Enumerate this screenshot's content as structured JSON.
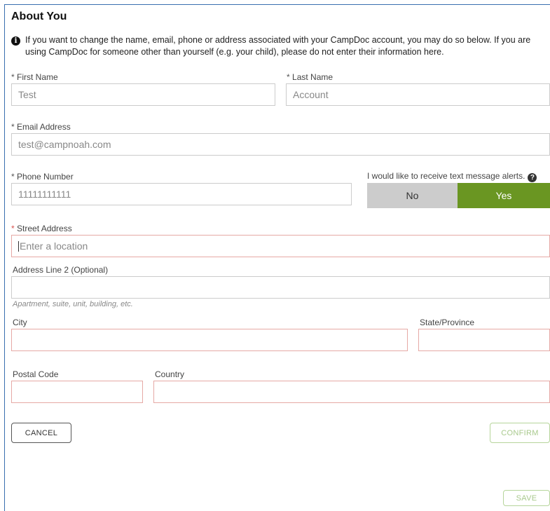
{
  "section": {
    "title": "About You",
    "info_text": "If you want to change the name, email, phone or address associated with your CampDoc account, you may do so below. If you are using CampDoc for someone other than yourself (e.g. your child), please do not enter their information here."
  },
  "icons": {
    "info": "info-circle-icon",
    "help": "question-circle-icon"
  },
  "form": {
    "first_name": {
      "label": "First Name",
      "value": "Test"
    },
    "last_name": {
      "label": "Last Name",
      "value": "Account"
    },
    "email": {
      "label": "Email Address",
      "value": "test@campnoah.com"
    },
    "phone": {
      "label": "Phone Number",
      "value": "11111111111"
    },
    "text_alerts": {
      "label": "I would like to receive text message alerts.",
      "no": "No",
      "yes": "Yes",
      "selected": "Yes"
    },
    "street": {
      "label": "Street Address",
      "placeholder": "Enter a location"
    },
    "address2": {
      "label": "Address Line 2 (Optional)",
      "hint": "Apartment, suite, unit, building, etc."
    },
    "city": {
      "label": "City"
    },
    "state": {
      "label": "State/Province"
    },
    "postal": {
      "label": "Postal Code"
    },
    "country": {
      "label": "Country"
    },
    "required_marker": "*"
  },
  "buttons": {
    "cancel": "CANCEL",
    "confirm": "CONFIRM",
    "save": "SAVE"
  },
  "colors": {
    "accent_green": "#6a9622",
    "error_border": "#e6a9a5",
    "required_red": "#d9534f",
    "frame_blue": "#3a6fb0"
  }
}
